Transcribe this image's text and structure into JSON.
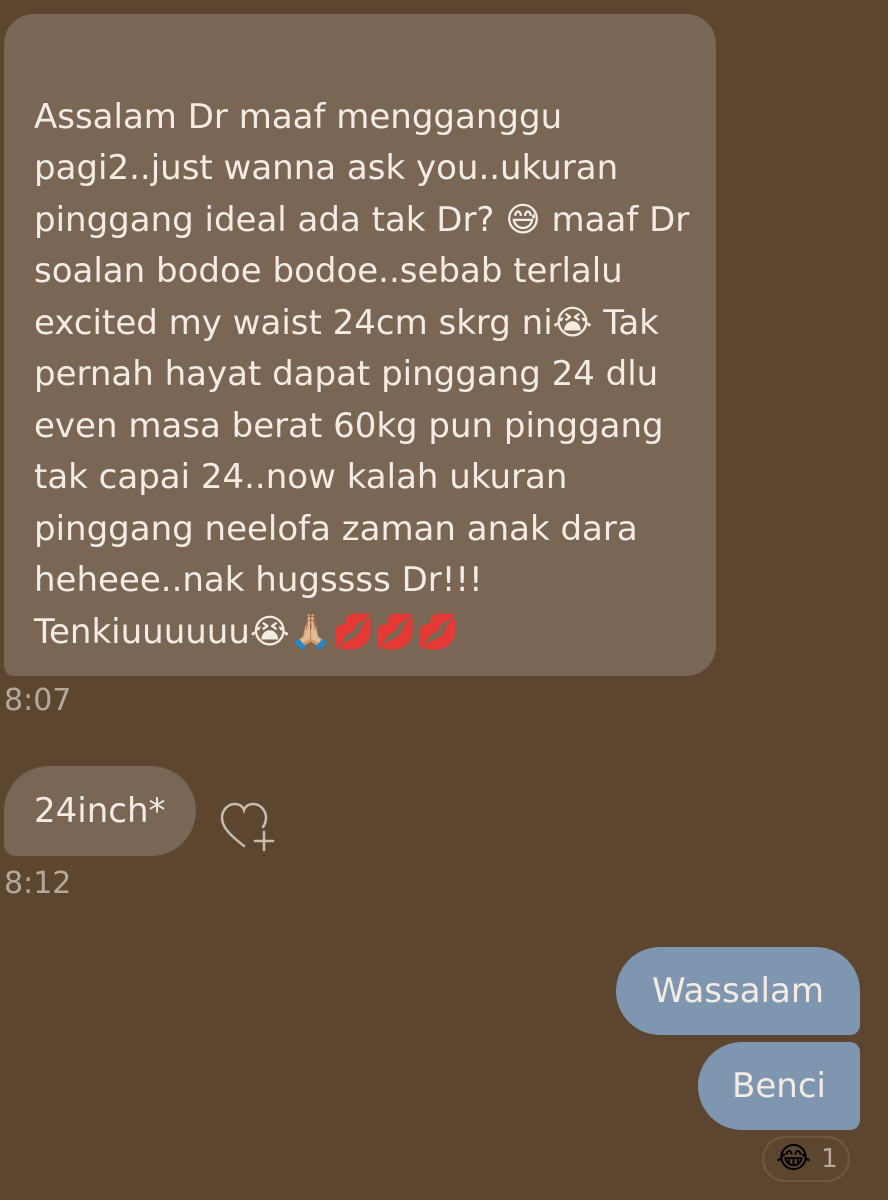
{
  "messages": [
    {
      "text": "Assalam Dr maaf mengganggu pagi2..just wanna ask you..ukuran pinggang ideal ada tak Dr? 😅 maaf Dr soalan bodoe bodoe..sebab terlalu excited my waist 24cm skrg ni😭 Tak pernah hayat dapat pinggang 24 dlu even masa berat 60kg pun pinggang tak capai 24..now kalah ukuran pinggang neelofa zaman anak dara heheee..nak hugssss Dr!!! Tenkiuuuuuu😭🙏🏼💋💋💋",
      "time": "8:07",
      "direction": "received"
    },
    {
      "text": "24inch*",
      "time": "8:12",
      "direction": "received"
    },
    {
      "text": "Wassalam",
      "direction": "sent"
    },
    {
      "text": "Benci",
      "direction": "sent",
      "reaction": {
        "emoji": "😂",
        "count": "1"
      }
    }
  ],
  "icons": {
    "react_button": "heart-plus-icon"
  },
  "colors": {
    "background": "#5d4630",
    "received_bubble": "#7a6655",
    "sent_bubble": "#7f96b0",
    "text": "#f4ebe2",
    "timestamp": "#b7a796"
  }
}
